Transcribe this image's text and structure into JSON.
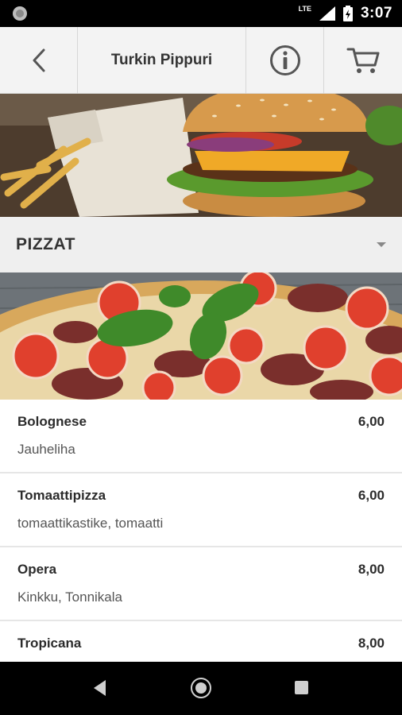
{
  "status_bar": {
    "network": "LTE",
    "time": "3:07",
    "icons": [
      "notification-icon",
      "signal-icon",
      "battery-icon"
    ]
  },
  "header": {
    "title": "Turkin Pippuri",
    "icons": [
      "back-icon",
      "info-icon",
      "cart-icon"
    ]
  },
  "category": {
    "label": "PIZZAT",
    "icon": "dropdown-caret-icon"
  },
  "menu": {
    "items": [
      {
        "name": "Bolognese",
        "price": "6,00",
        "description": "Jauheliha"
      },
      {
        "name": "Tomaattipizza",
        "price": "6,00",
        "description": "tomaattikastike, tomaatti"
      },
      {
        "name": "Opera",
        "price": "8,00",
        "description": "Kinkku, Tonnikala"
      },
      {
        "name": "Tropicana",
        "price": "8,00",
        "description": ""
      }
    ]
  },
  "nav_bar": {
    "icons": [
      "nav-back-icon",
      "nav-home-icon",
      "nav-recents-icon"
    ]
  },
  "colors": {
    "header_bg": "#f3f3f3",
    "category_bg": "#efefef",
    "text_primary": "#2b2b2b",
    "text_secondary": "#555555"
  }
}
